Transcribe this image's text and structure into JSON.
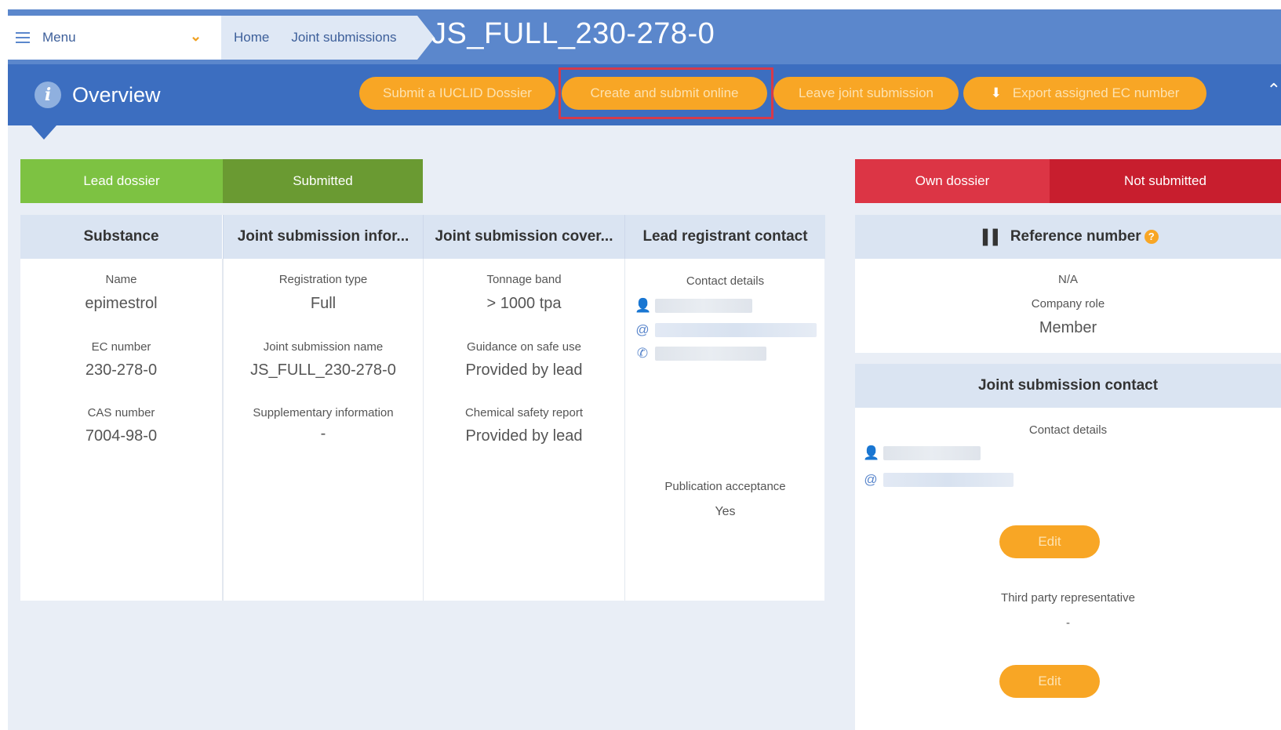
{
  "menu": {
    "label": "Menu"
  },
  "breadcrumb": {
    "home": "Home",
    "joint_submissions": "Joint submissions"
  },
  "page_title": "JS_FULL_230-278-0",
  "overview": {
    "title": "Overview",
    "buttons": {
      "submit_iuclid": "Submit a IUCLID Dossier",
      "create_submit": "Create and submit online",
      "leave_js": "Leave joint submission",
      "export_ec": "Export assigned EC number"
    }
  },
  "lead_tags": {
    "lead_dossier": "Lead dossier",
    "submitted": "Submitted"
  },
  "own_tags": {
    "own_dossier": "Own dossier",
    "not_submitted": "Not submitted"
  },
  "columns": {
    "substance": {
      "header": "Substance",
      "name_label": "Name",
      "name_value": "epimestrol",
      "ec_label": "EC number",
      "ec_value": "230-278-0",
      "cas_label": "CAS number",
      "cas_value": "7004-98-0"
    },
    "js_info": {
      "header": "Joint submission infor...",
      "reg_type_label": "Registration type",
      "reg_type_value": "Full",
      "js_name_label": "Joint submission name",
      "js_name_value": "JS_FULL_230-278-0",
      "supp_label": "Supplementary information",
      "supp_value": "-"
    },
    "js_cover": {
      "header": "Joint submission cover...",
      "tonnage_label": "Tonnage band",
      "tonnage_value": "> 1000 tpa",
      "guidance_label": "Guidance on safe use",
      "guidance_value": "Provided by lead",
      "csr_label": "Chemical safety report",
      "csr_value": "Provided by lead"
    },
    "lead_contact": {
      "header": "Lead registrant contact",
      "contact_label": "Contact details",
      "publication_label": "Publication acceptance",
      "publication_value": "Yes"
    }
  },
  "reference": {
    "header": "Reference number",
    "value": "N/A",
    "role_label": "Company role",
    "role_value": "Member"
  },
  "js_contact": {
    "header": "Joint submission contact",
    "contact_label": "Contact details",
    "edit_label": "Edit",
    "third_party_label": "Third party representative",
    "third_party_value": "-",
    "edit2_label": "Edit"
  },
  "colors": {
    "topbar": "#5b87cc",
    "overview_bar": "#3c6ec0",
    "orange": "#f8a625",
    "green_light": "#7dc242",
    "green_dark": "#6a9a32",
    "red_light": "#dc3545",
    "red_dark": "#c81e2e"
  }
}
